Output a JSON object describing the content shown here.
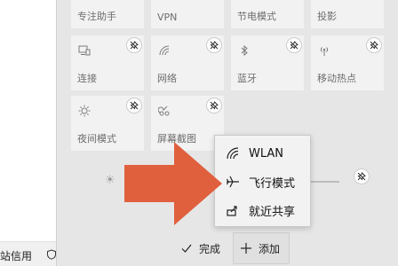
{
  "background_window": {
    "bottom_text": "站信用"
  },
  "tiles": [
    {
      "label": "专注助手"
    },
    {
      "label": "VPN"
    },
    {
      "label": "节电模式"
    },
    {
      "label": "投影"
    },
    {
      "label": "连接",
      "icon": "connect-icon"
    },
    {
      "label": "网络",
      "icon": "network-icon"
    },
    {
      "label": "蓝牙",
      "icon": "bluetooth-icon"
    },
    {
      "label": "移动热点",
      "icon": "hotspot-icon"
    },
    {
      "label": "夜间模式",
      "icon": "night-light-icon"
    },
    {
      "label": "屏幕截图",
      "icon": "snip-icon"
    }
  ],
  "menu": {
    "items": [
      {
        "label": "WLAN",
        "icon": "wlan-icon"
      },
      {
        "label": "飞行模式",
        "icon": "airplane-icon"
      },
      {
        "label": "就近共享",
        "icon": "nearby-share-icon"
      }
    ]
  },
  "buttons": {
    "done_label": "完成",
    "add_label": "添加"
  },
  "colors": {
    "arrow": "#e0603e",
    "panel_bg": "#e6e6e6",
    "tile_bg": "#f2f2f2"
  }
}
